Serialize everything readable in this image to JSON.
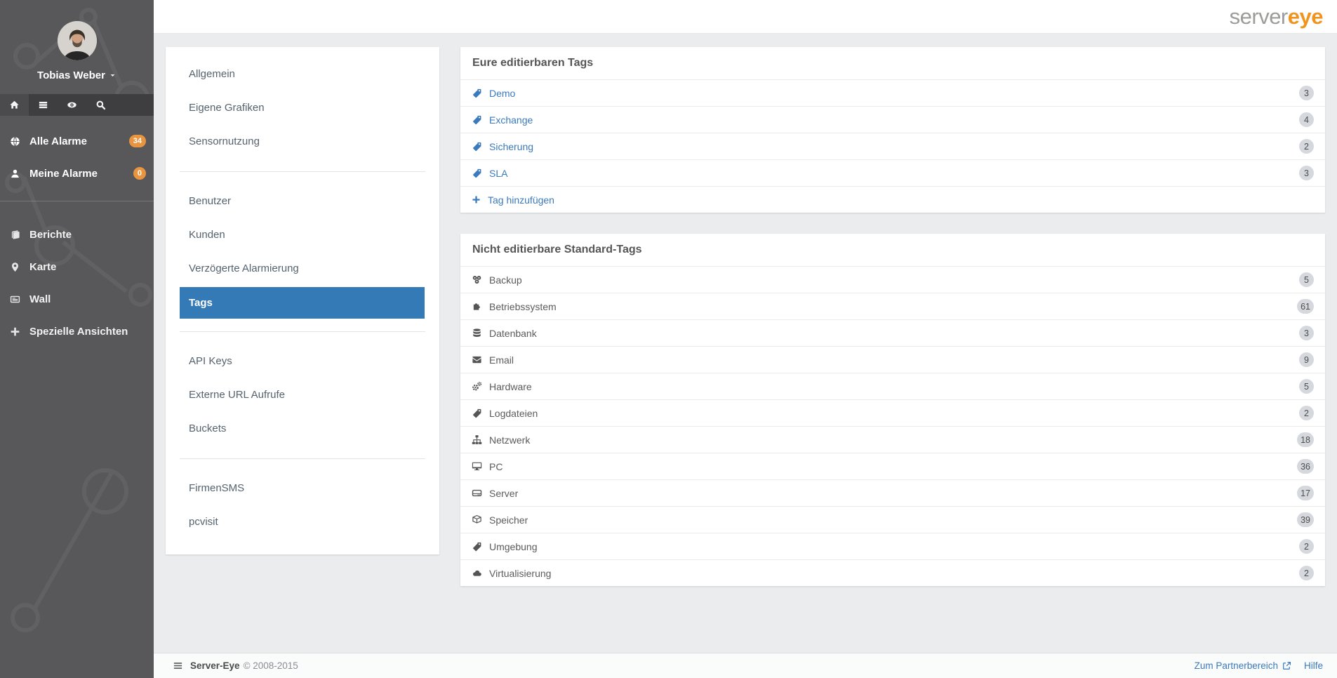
{
  "header": {
    "logo": {
      "gray": "server",
      "orange": "eye"
    }
  },
  "sidebar": {
    "user": {
      "name": "Tobias Weber"
    },
    "iconbar": [
      {
        "icon": "home-icon",
        "active": true
      },
      {
        "icon": "list-icon"
      },
      {
        "icon": "eye-icon"
      },
      {
        "icon": "search-icon"
      }
    ],
    "alarm_items": [
      {
        "icon": "globe-icon",
        "label": "Alle Alarme",
        "count": "34"
      },
      {
        "icon": "user-icon",
        "label": "Meine Alarme",
        "count": "0"
      }
    ],
    "nav_items": [
      {
        "icon": "book-icon",
        "label": "Berichte"
      },
      {
        "icon": "map-marker-icon",
        "label": "Karte"
      },
      {
        "icon": "newspaper-icon",
        "label": "Wall"
      },
      {
        "icon": "plus-icon",
        "label": "Spezielle Ansichten"
      }
    ]
  },
  "settings_menu": {
    "groups": [
      {
        "items": [
          {
            "label": "Allgemein"
          },
          {
            "label": "Eigene Grafiken"
          },
          {
            "label": "Sensornutzung"
          }
        ]
      },
      {
        "items": [
          {
            "label": "Benutzer"
          },
          {
            "label": "Kunden"
          },
          {
            "label": "Verzögerte Alarmierung"
          },
          {
            "label": "Tags",
            "active": true
          }
        ]
      },
      {
        "items": [
          {
            "label": "API Keys"
          },
          {
            "label": "Externe URL Aufrufe"
          },
          {
            "label": "Buckets"
          }
        ]
      },
      {
        "items": [
          {
            "label": "FirmenSMS"
          },
          {
            "label": "pcvisit"
          }
        ]
      }
    ]
  },
  "editable_tags": {
    "title": "Eure editierbaren Tags",
    "items": [
      {
        "icon": "tag-icon",
        "label": "Demo",
        "count": "3"
      },
      {
        "icon": "tag-icon",
        "label": "Exchange",
        "count": "4"
      },
      {
        "icon": "tag-icon",
        "label": "Sicherung",
        "count": "2"
      },
      {
        "icon": "tag-icon",
        "label": "SLA",
        "count": "3"
      }
    ],
    "add_label": "Tag hinzufügen"
  },
  "standard_tags": {
    "title": "Nicht editierbare Standard-Tags",
    "items": [
      {
        "icon": "backup-icon",
        "label": "Backup",
        "count": "5"
      },
      {
        "icon": "os-puzzle-icon",
        "label": "Betriebssystem",
        "count": "61"
      },
      {
        "icon": "database-icon",
        "label": "Datenbank",
        "count": "3"
      },
      {
        "icon": "envelope-icon",
        "label": "Email",
        "count": "9"
      },
      {
        "icon": "gears-icon",
        "label": "Hardware",
        "count": "5"
      },
      {
        "icon": "tag-icon",
        "label": "Logdateien",
        "count": "2"
      },
      {
        "icon": "sitemap-icon",
        "label": "Netzwerk",
        "count": "18"
      },
      {
        "icon": "desktop-icon",
        "label": "PC",
        "count": "36"
      },
      {
        "icon": "harddrive-icon",
        "label": "Server",
        "count": "17"
      },
      {
        "icon": "cube-icon",
        "label": "Speicher",
        "count": "39"
      },
      {
        "icon": "tag-icon",
        "label": "Umgebung",
        "count": "2"
      },
      {
        "icon": "cloud-icon",
        "label": "Virtualisierung",
        "count": "2"
      }
    ]
  },
  "footer": {
    "brand": "Server-Eye",
    "copyright": "© 2008-2015",
    "partner_label": "Zum Partnerbereich",
    "help_label": "Hilfe"
  },
  "colors": {
    "accent_blue": "#337ab7",
    "link_blue": "#3a7abd",
    "badge_orange": "#e9953f",
    "logo_orange": "#f0941e",
    "sidebar_gray": "#58585a",
    "iconbar_gray": "#3e3e41",
    "badge_gray": "#d5d9dd",
    "background": "#eaecee"
  }
}
